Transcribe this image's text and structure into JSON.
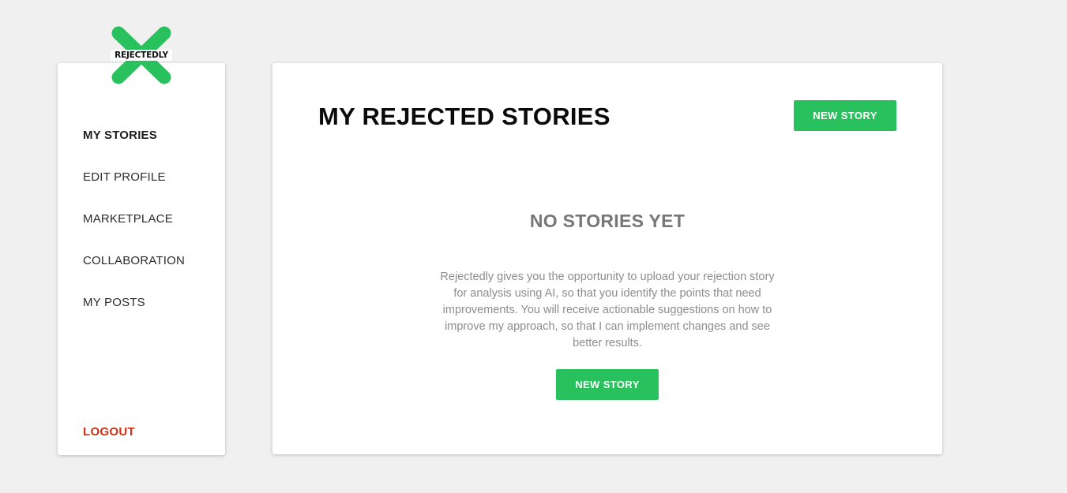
{
  "brand": {
    "name": "REJECTEDLY",
    "logo_icon": "x-mark-icon",
    "accent_color": "#29c15d"
  },
  "sidebar": {
    "items": [
      {
        "label": "MY STORIES",
        "active": true
      },
      {
        "label": "EDIT PROFILE",
        "active": false
      },
      {
        "label": "MARKETPLACE",
        "active": false
      },
      {
        "label": "COLLABORATION",
        "active": false
      },
      {
        "label": "MY POSTS",
        "active": false
      }
    ],
    "logout_label": "LOGOUT",
    "logout_color": "#d42e12"
  },
  "main": {
    "title": "MY REJECTED STORIES",
    "new_story_label": "NEW STORY",
    "empty_state": {
      "title": "NO STORIES YET",
      "description": "Rejectedly gives you the opportunity to upload your rejection story for analysis using AI, so that you identify the points that need improvements. You will receive actionable suggestions on how to improve my approach, so that I can implement changes and see better results.",
      "button_label": "NEW STORY"
    }
  }
}
